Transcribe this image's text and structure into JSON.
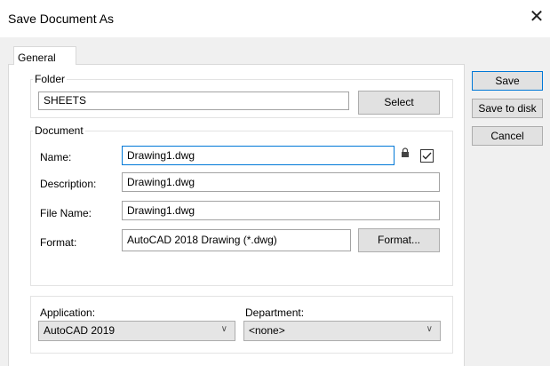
{
  "window": {
    "title": "Save Document As",
    "close_glyph": "✕"
  },
  "tabs": [
    {
      "label": "General"
    }
  ],
  "folder": {
    "legend": "Folder",
    "value": "SHEETS",
    "select_label": "Select"
  },
  "document": {
    "legend": "Document",
    "name_label": "Name:",
    "name_value": "Drawing1.dwg",
    "description_label": "Description:",
    "description_value": "Drawing1.dwg",
    "filename_label": "File Name:",
    "filename_value": "Drawing1.dwg",
    "format_label": "Format:",
    "format_value": "AutoCAD 2018 Drawing (*.dwg)",
    "format_button": "Format...",
    "lock_icon": "lock-icon",
    "checkbox_checked": true
  },
  "bottom": {
    "application_label": "Application:",
    "application_value": "AutoCAD 2019",
    "department_label": "Department:",
    "department_value": "<none>"
  },
  "actions": {
    "save": "Save",
    "save_to_disk": "Save to disk",
    "cancel": "Cancel"
  },
  "colors": {
    "focus": "#0078d7",
    "panel": "#ffffff",
    "background": "#f0f0f0"
  }
}
